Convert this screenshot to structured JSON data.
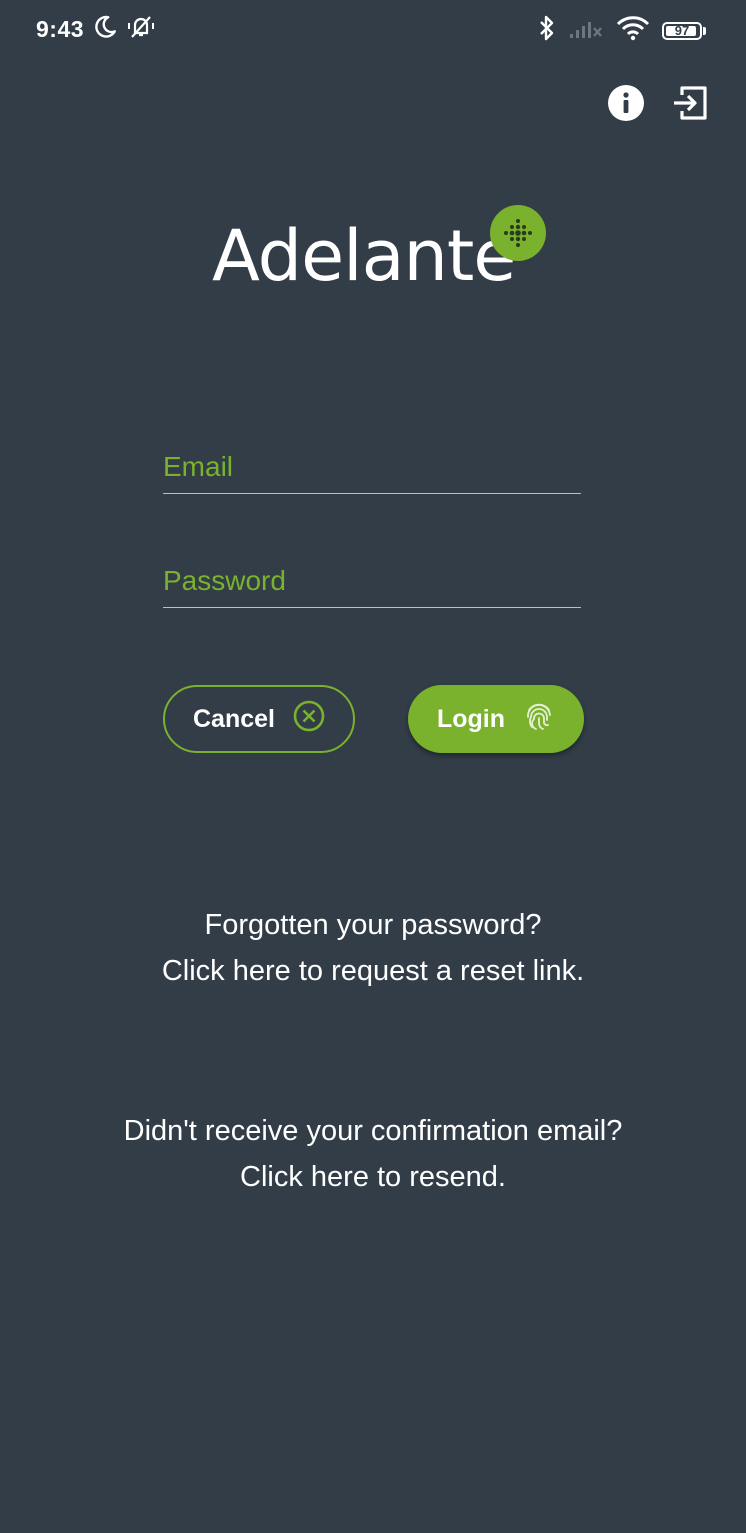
{
  "status_bar": {
    "time": "9:43",
    "battery_level": "97",
    "icons": [
      "moon-icon",
      "bell-off-icon",
      "bluetooth-icon",
      "signal-icon",
      "wifi-icon",
      "battery-icon"
    ]
  },
  "top_actions": {
    "info_icon": "info-icon",
    "login_icon": "login-arrow-icon"
  },
  "logo": {
    "text": "Adelante",
    "accent_color": "#7ab22e"
  },
  "form": {
    "email": {
      "placeholder": "Email",
      "value": ""
    },
    "password": {
      "placeholder": "Password",
      "value": ""
    }
  },
  "buttons": {
    "cancel_label": "Cancel",
    "login_label": "Login"
  },
  "links": {
    "forgot_line1": "Forgotten your password?",
    "forgot_line2": "Click here to request a reset link.",
    "resend_line1": "Didn't receive your confirmation email?",
    "resend_line2": "Click here to resend."
  },
  "colors": {
    "background": "#323d48",
    "accent": "#7ab22e",
    "text": "#ffffff"
  }
}
